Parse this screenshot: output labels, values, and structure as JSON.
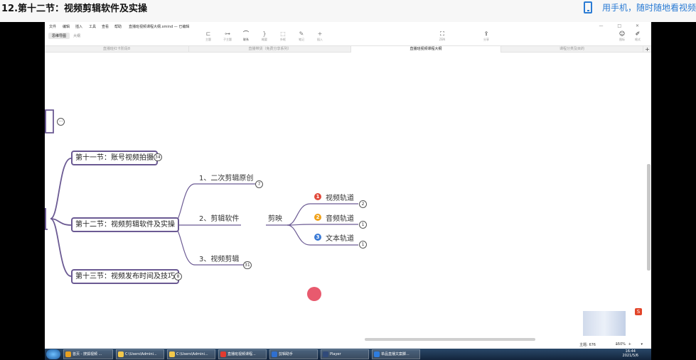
{
  "page": {
    "title": "12.第十二节：视频剪辑软件及实操",
    "mobile_tip": "用手机，随时随地看视频"
  },
  "app": {
    "menu": [
      "文件",
      "编辑",
      "插入",
      "工具",
      "查看",
      "帮助"
    ],
    "file_title": "直播班视频课程大纲.xmind — 已编辑",
    "window_buttons": "— □ ✕",
    "toolbar": [
      {
        "icon": "topic-icon",
        "label": "主题"
      },
      {
        "icon": "subtopic-icon",
        "label": "子主题"
      },
      {
        "icon": "relation-icon",
        "label": "联系"
      },
      {
        "icon": "summary-icon",
        "label": "概要"
      },
      {
        "icon": "boundary-icon",
        "label": "外框"
      },
      {
        "icon": "note-icon",
        "label": "笔记"
      },
      {
        "icon": "insert-icon",
        "label": "插入"
      }
    ],
    "zen_label": "ZEN",
    "share_label": "分享",
    "icon_label": "图标",
    "format_label": "格式",
    "view_modes": [
      "思维导图",
      "大纲"
    ],
    "tabs": [
      "直播班红卡阶段8",
      "直播带货（免费分享系列）",
      "直播班视频课程大纲",
      "课程分类及目的"
    ],
    "active_tab": 2
  },
  "mindmap": {
    "topics": [
      {
        "label": "第十一节：账号视频拍摄",
        "count": "34"
      },
      {
        "label": "第十二节：视频剪辑软件及实操"
      },
      {
        "label": "第十三节：视频发布时间及技巧",
        "count": "8"
      }
    ],
    "subtopics": [
      {
        "label": "1、二次剪辑原创",
        "count": "7"
      },
      {
        "label": "2、剪辑软件"
      },
      {
        "label": "3、视频剪辑",
        "count": "31"
      }
    ],
    "software": "剪映",
    "tracks": [
      {
        "marker": "1",
        "color": "#e24a3b",
        "label": "视频轨道",
        "count": "2"
      },
      {
        "marker": "2",
        "color": "#f0a21b",
        "label": "音频轨道",
        "count": "1"
      },
      {
        "marker": "3",
        "color": "#3b7bd6",
        "label": "文本轨道",
        "count": "1"
      }
    ],
    "top_badge": "···"
  },
  "statusbar": {
    "topic_count": "主题: 676",
    "zoom": "150%",
    "controls": "— + ▾"
  },
  "taskbar": {
    "items": [
      {
        "label": "首页 - 搜狐视频 ...",
        "color": "#e8a020"
      },
      {
        "label": "C:\\Users\\Admini...",
        "color": "#f3c84a"
      },
      {
        "label": "C:\\Users\\Admini...",
        "color": "#f3c84a"
      },
      {
        "label": "直播班视频课程...",
        "color": "#e23b30"
      },
      {
        "label": "剪辑助手",
        "color": "#2f6fd0"
      },
      {
        "label": "Player",
        "color": "#304a7a"
      },
      {
        "label": "单品直播文案脚...",
        "color": "#2e7de0"
      }
    ],
    "time": "16:44",
    "date": "2021/5/6"
  }
}
